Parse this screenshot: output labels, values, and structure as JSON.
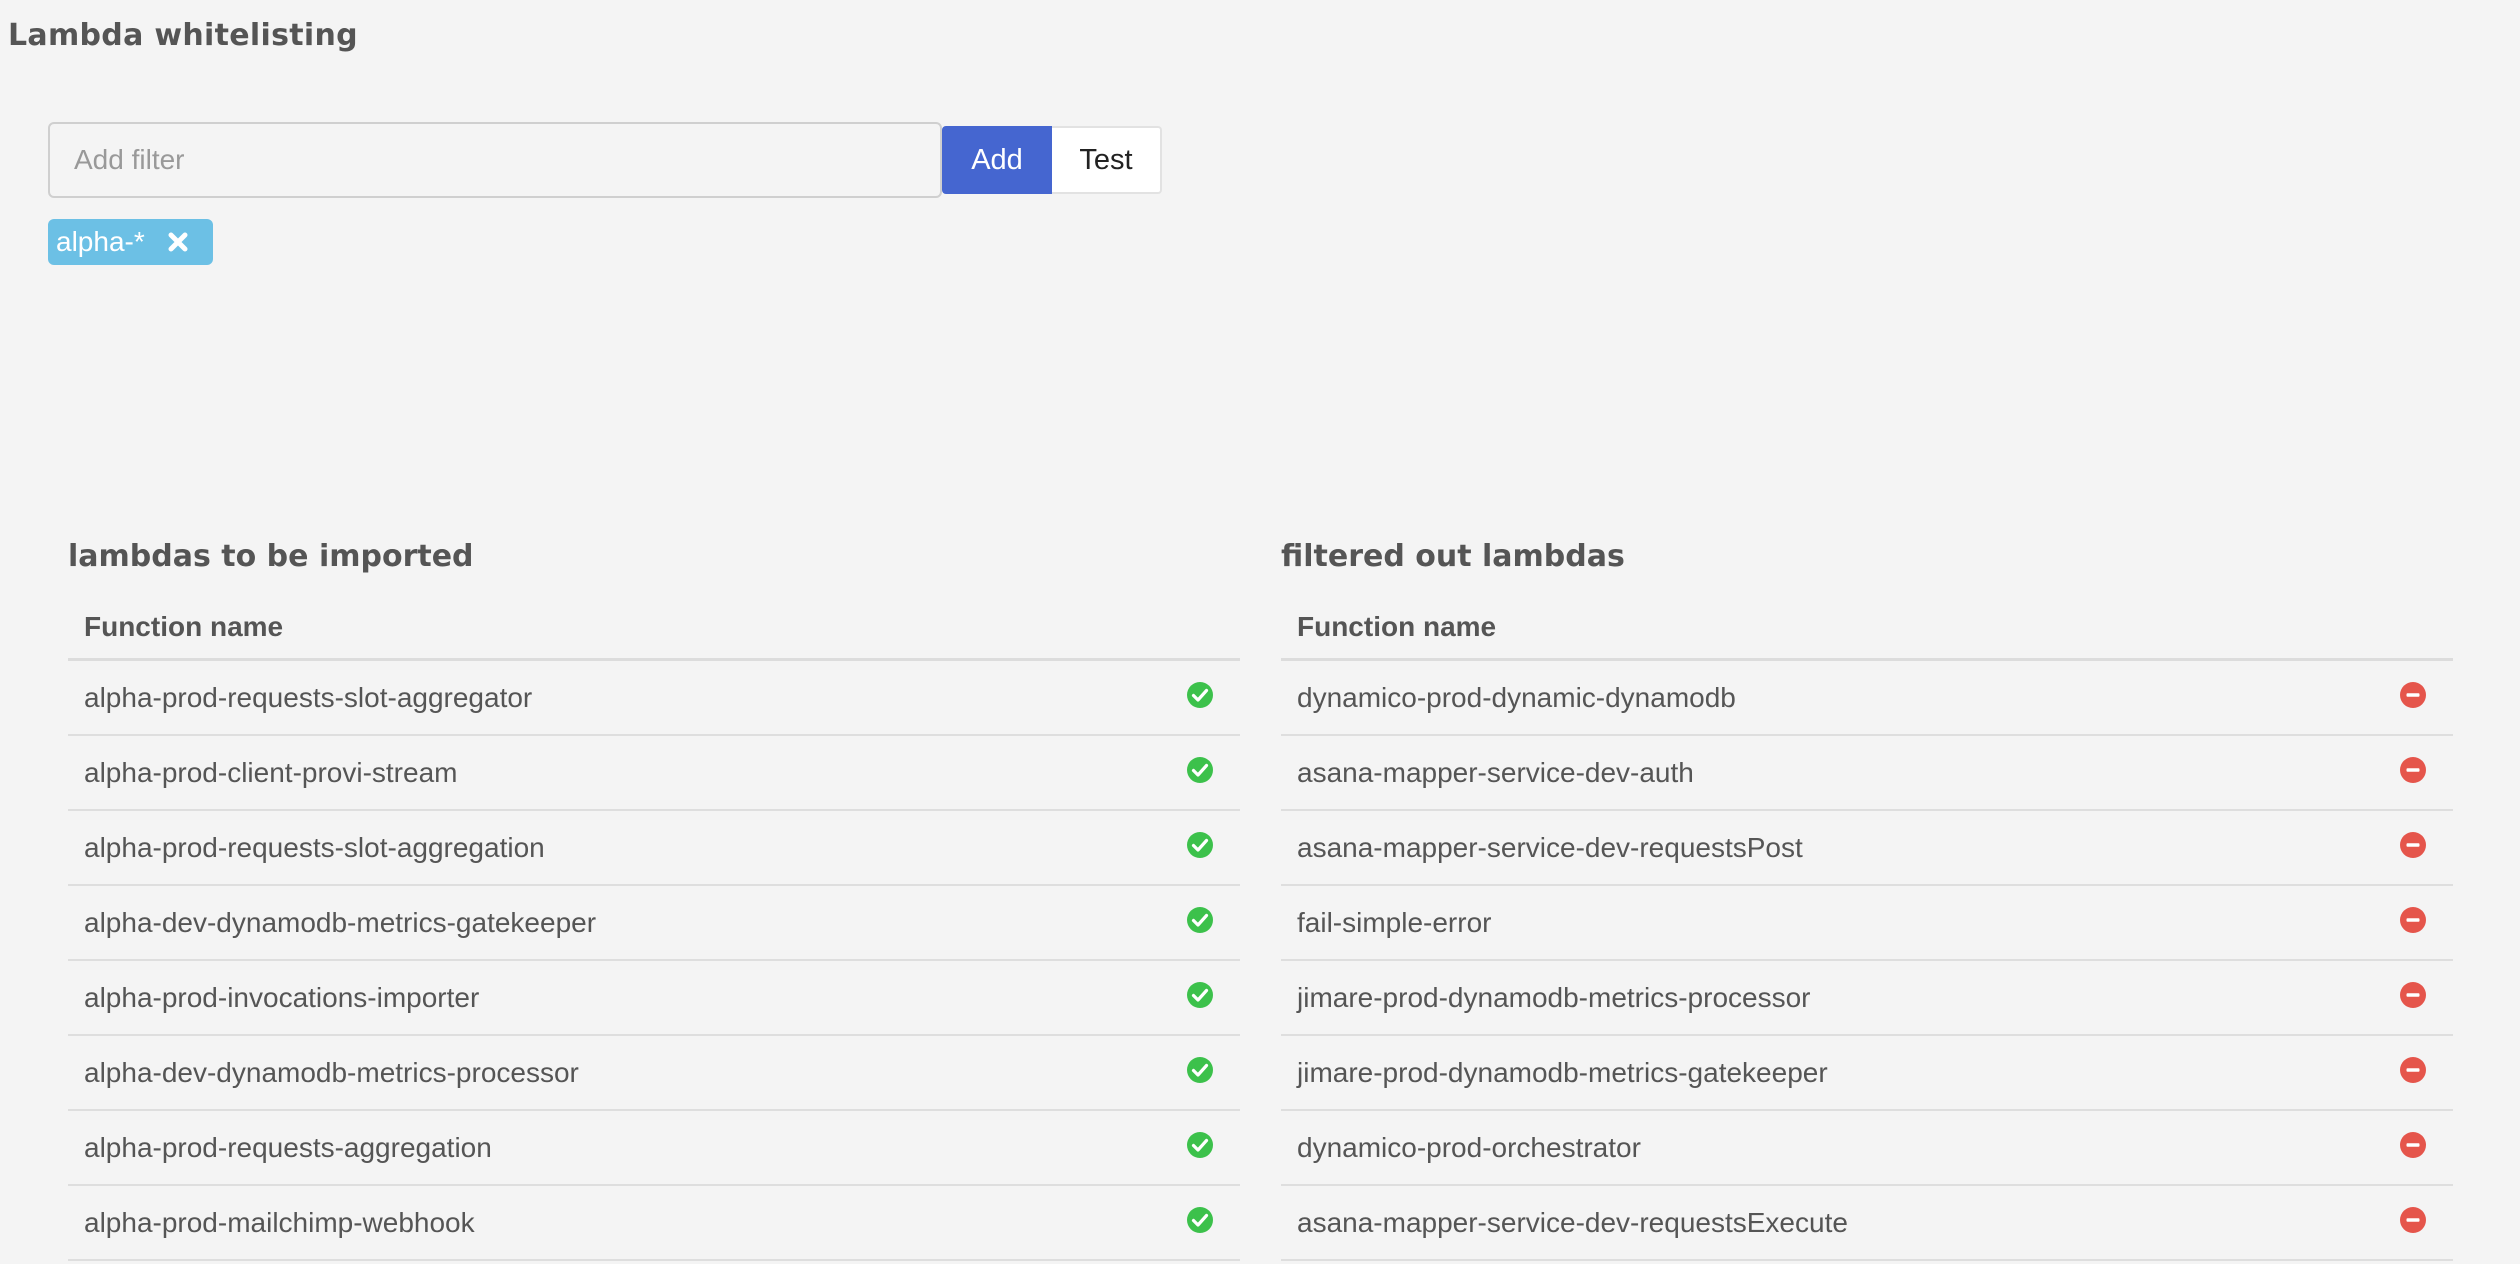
{
  "page": {
    "title": "Lambda whitelisting"
  },
  "filter": {
    "placeholder": "Add filter",
    "value": "",
    "add_label": "Add",
    "test_label": "Test"
  },
  "tags": [
    {
      "label": "alpha-*",
      "icon": "close-icon"
    }
  ],
  "colors": {
    "accent": "#4566d0",
    "tag": "#6cc0e5",
    "included": "#3cc14b",
    "excluded": "#e5554b"
  },
  "imported": {
    "title": "lambdas to be imported",
    "column_header": "Function name",
    "status_icon": "check-circle-icon",
    "rows": [
      "alpha-prod-requests-slot-aggregator",
      "alpha-prod-client-provi-stream",
      "alpha-prod-requests-slot-aggregation",
      "alpha-dev-dynamodb-metrics-gatekeeper",
      "alpha-prod-invocations-importer",
      "alpha-dev-dynamodb-metrics-processor",
      "alpha-prod-requests-aggregation",
      "alpha-prod-mailchimp-webhook"
    ]
  },
  "filtered": {
    "title": "filtered out lambdas",
    "column_header": "Function name",
    "status_icon": "minus-circle-icon",
    "rows": [
      "dynamico-prod-dynamic-dynamodb",
      "asana-mapper-service-dev-auth",
      "asana-mapper-service-dev-requestsPost",
      "fail-simple-error",
      "jimare-prod-dynamodb-metrics-processor",
      "jimare-prod-dynamodb-metrics-gatekeeper",
      "dynamico-prod-orchestrator",
      "asana-mapper-service-dev-requestsExecute"
    ]
  }
}
